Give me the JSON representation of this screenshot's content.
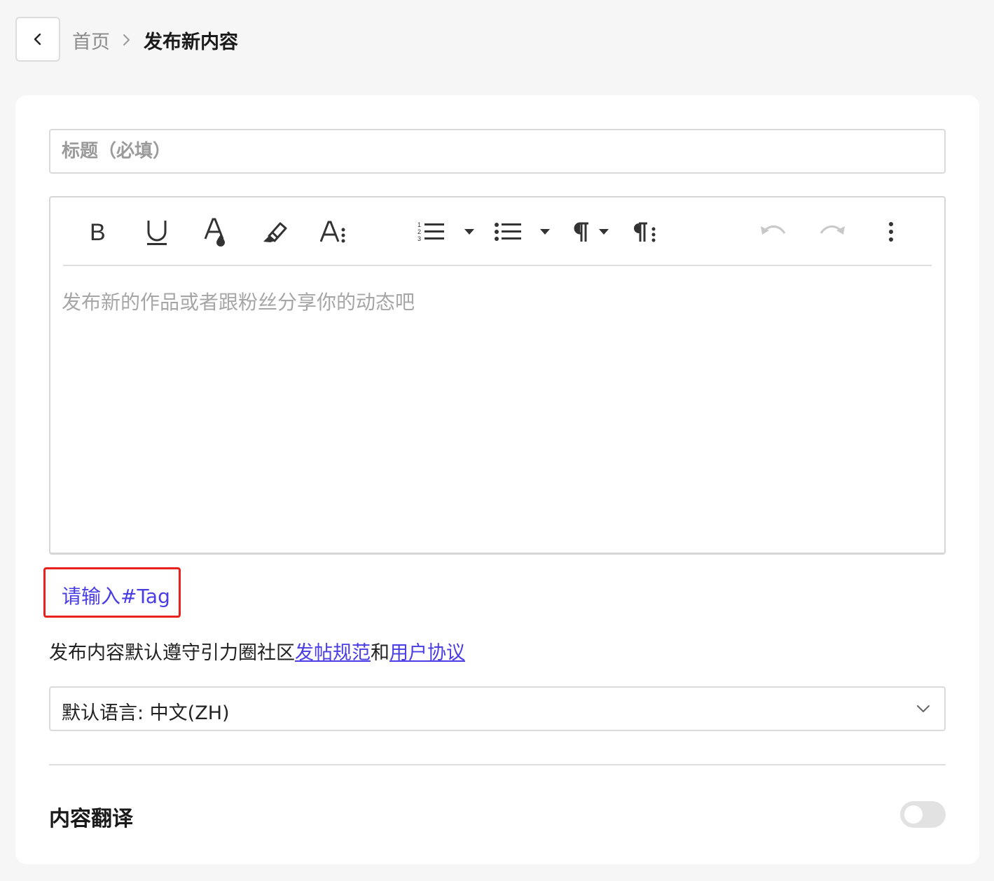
{
  "breadcrumb": {
    "home": "首页",
    "current": "发布新内容"
  },
  "title_field": {
    "placeholder": "标题（必填）",
    "value": ""
  },
  "editor": {
    "placeholder": "发布新的作品或者跟粉丝分享你的动态吧",
    "toolbar": [
      "bold-icon",
      "underline-icon",
      "font-color-icon",
      "highlight-icon",
      "font-size-icon",
      "ordered-list-icon",
      "unordered-list-icon",
      "paragraph-icon",
      "paragraph-format-icon",
      "undo-icon",
      "redo-icon",
      "more-icon"
    ]
  },
  "tag_input": {
    "placeholder": "请输入#Tag"
  },
  "agreement": {
    "prefix": "发布内容默认遵守引力圈社区",
    "link1": "发帖规范",
    "mid": "和",
    "link2": "用户协议"
  },
  "language_select": {
    "value": "默认语言: 中文(ZH)"
  },
  "translation": {
    "label": "内容翻译",
    "enabled": false
  },
  "colors": {
    "accent": "#4a3de6",
    "highlight_border": "#e8211c"
  }
}
